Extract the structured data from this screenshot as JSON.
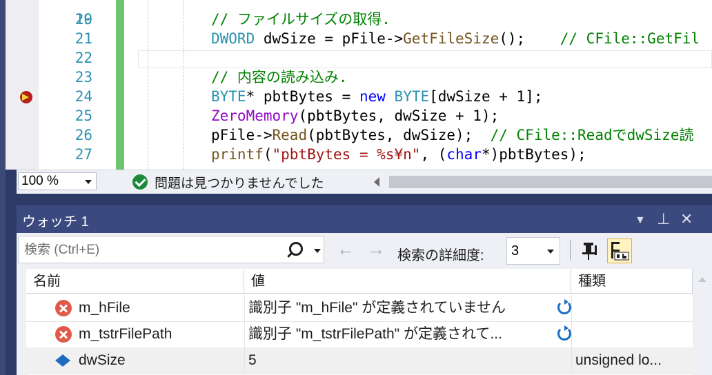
{
  "editor": {
    "top_partial_line": "19",
    "lines": [
      {
        "num": "20",
        "segments": [
          {
            "t": "// ファイルサイズの取得.",
            "c": "cmt"
          }
        ]
      },
      {
        "num": "21",
        "segments": [
          {
            "t": "DWORD",
            "c": "typ"
          },
          {
            "t": " dwSize = pFile->",
            "c": ""
          },
          {
            "t": "GetFileSize",
            "c": "fn"
          },
          {
            "t": "();    ",
            "c": ""
          },
          {
            "t": "// CFile::GetFil",
            "c": "cmt"
          }
        ]
      },
      {
        "num": "22",
        "segments": []
      },
      {
        "num": "23",
        "segments": [
          {
            "t": "// 内容の読み込み.",
            "c": "cmt"
          }
        ]
      },
      {
        "num": "24",
        "segments": [
          {
            "t": "BYTE",
            "c": "typ"
          },
          {
            "t": "* pbtBytes = ",
            "c": ""
          },
          {
            "t": "new",
            "c": "kw"
          },
          {
            "t": " ",
            "c": ""
          },
          {
            "t": "BYTE",
            "c": "typ"
          },
          {
            "t": "[dwSize + 1];",
            "c": ""
          }
        ]
      },
      {
        "num": "25",
        "segments": [
          {
            "t": "ZeroMemory",
            "c": "mac"
          },
          {
            "t": "(pbtBytes, dwSize + 1);",
            "c": ""
          }
        ]
      },
      {
        "num": "26",
        "segments": [
          {
            "t": "pFile->",
            "c": ""
          },
          {
            "t": "Read",
            "c": "fn"
          },
          {
            "t": "(pbtBytes, dwSize);  ",
            "c": ""
          },
          {
            "t": "// CFile::ReadでdwSize読",
            "c": "cmt"
          }
        ]
      },
      {
        "num": "27",
        "segments": [
          {
            "t": "printf",
            "c": "fn"
          },
          {
            "t": "(",
            "c": ""
          },
          {
            "t": "\"pbtBytes = %s¥n\"",
            "c": "str"
          },
          {
            "t": ", (",
            "c": ""
          },
          {
            "t": "char",
            "c": "kw"
          },
          {
            "t": "*)pbtBytes);",
            "c": ""
          }
        ]
      }
    ]
  },
  "status": {
    "zoom": "100 %",
    "message": "問題は見つかりませんでした"
  },
  "watch": {
    "title": "ウォッチ 1",
    "search_placeholder": "検索 (Ctrl+E)",
    "depth_label": "検索の詳細度:",
    "depth_value": "3",
    "columns": {
      "name": "名前",
      "value": "値",
      "type": "種類"
    },
    "rows": [
      {
        "name": "m_hFile",
        "value": "識別子 \"m_hFile\" が定義されていません",
        "type": "",
        "icon": "error-icon"
      },
      {
        "name": "m_tstrFilePath",
        "value": "識別子 \"m_tstrFilePath\" が定義されて...",
        "type": "",
        "icon": "error-icon"
      },
      {
        "name": "dwSize",
        "value": "5",
        "type": "unsigned lo...",
        "icon": "variable-icon"
      }
    ]
  },
  "colors": {
    "breakpoint": "#b51f16",
    "change_bar": "#6fc46f",
    "title_bar": "#3b4a7e",
    "comment": "#008000",
    "keyword": "#0000ff"
  }
}
